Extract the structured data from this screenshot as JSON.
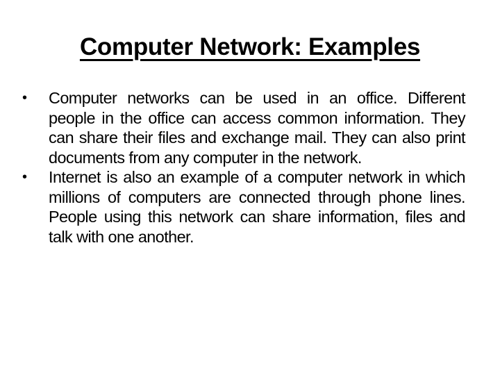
{
  "slide": {
    "title": "Computer Network: Examples",
    "bullet_glyph": "•",
    "bullets": [
      {
        "text": "Computer networks can be used in an office. Different people in the office can access common information. They can share their files and exchange mail. They can also print documents from any computer in the network."
      },
      {
        "text": "Internet is also an example of a computer network in which millions of computers are connected through phone lines. People using this network can share information, files and talk with one another."
      }
    ]
  }
}
